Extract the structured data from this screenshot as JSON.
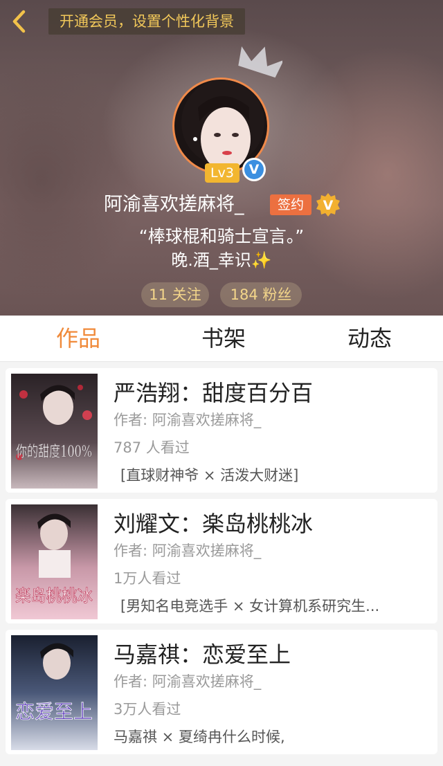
{
  "header": {
    "promo": "开通会员，设置个性化背景"
  },
  "profile": {
    "level": "Lv3",
    "name": "阿渝喜欢搓麻将_",
    "signed_badge": "签约",
    "vip_badge": "V",
    "verified_badge": "V",
    "quote": "“棒球棍和骑士宣言。”",
    "subtitle": "晚.酒_幸识✨",
    "following": "11 关注",
    "followers": "184 粉丝"
  },
  "tabs": [
    {
      "label": "作品",
      "active": true
    },
    {
      "label": "书架",
      "active": false
    },
    {
      "label": "动态",
      "active": false
    }
  ],
  "works": [
    {
      "title": "严浩翔：甜度百分百",
      "author": "作者: 阿渝喜欢搓麻将_",
      "reads": "787 人看过",
      "tagline": "[直球财神爷 × 活泼大财迷]",
      "cover_text": "你的甜度100%"
    },
    {
      "title": "刘耀文：楽岛桃桃冰",
      "author": "作者: 阿渝喜欢搓麻将_",
      "reads": "1万人看过",
      "tagline": "[男知名电竞选手 × 女计算机系研究生...",
      "cover_text": "楽岛桃桃冰"
    },
    {
      "title": "马嘉祺：恋爱至上",
      "author": "作者: 阿渝喜欢搓麻将_",
      "reads": "3万人看过",
      "tagline": "马嘉祺 × 夏绮冉什么时候,",
      "cover_text": "恋爱至上"
    }
  ],
  "colors": {
    "accent": "#f08a3a",
    "promo_text": "#f2c85a",
    "sign_badge": "#ec7040",
    "level_badge": "#f2b630",
    "verified": "#3b8fe0"
  },
  "icons": {
    "back": "chevron-left-icon",
    "crown": "crown-icon",
    "verified": "verified-icon",
    "vip": "vip-icon"
  }
}
